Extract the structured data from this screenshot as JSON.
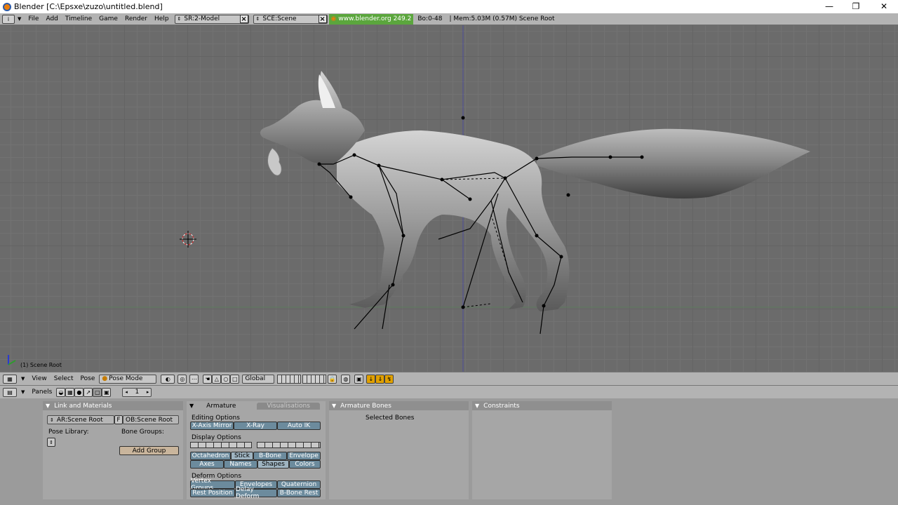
{
  "window": {
    "title": "Blender [C:\\Epsxe\\zuzo\\untitled.blend]",
    "minimize": "—",
    "restore": "❐",
    "close": "✕"
  },
  "menubar": {
    "items": [
      "File",
      "Add",
      "Timeline",
      "Game",
      "Render",
      "Help"
    ],
    "screen_field": "SR:2-Model",
    "scene_field": "SCE:Scene",
    "url": "www.blender.org 249.2",
    "stats_bo": "Bo:0-48",
    "stats_mem": "| Mem:5.03M (0.57M) Scene Root"
  },
  "viewport": {
    "object_label": "(1) Scene Root"
  },
  "view3d_header": {
    "menus": [
      "View",
      "Select",
      "Pose"
    ],
    "mode": "Pose Mode",
    "orientation": "Global"
  },
  "buttons_header": {
    "panels_label": "Panels",
    "frame": "1"
  },
  "panels": {
    "link": {
      "title": "Link and Materials",
      "ar_field": "AR:Scene Root",
      "f_btn": "F",
      "ob_field": "OB:Scene Root",
      "pose_library": "Pose Library:",
      "bone_groups": "Bone Groups:",
      "add_group": "Add Group"
    },
    "armature": {
      "tab_active": "Armature",
      "tab_other": "Visualisations",
      "editing": "Editing Options",
      "x_axis_mirror": "X-Axis Mirror",
      "x_ray": "X-Ray",
      "auto_ik": "Auto IK",
      "display": "Display Options",
      "octahedron": "Octahedron",
      "stick": "Stick",
      "b_bone": "B-Bone",
      "envelope": "Envelope",
      "axes": "Axes",
      "names": "Names",
      "shapes": "Shapes",
      "colors": "Colors",
      "deform": "Deform Options",
      "vertex_groups": "Vertex Groups",
      "envelopes": "Envelopes",
      "quaternion": "Quaternion",
      "rest_position": "Rest Position",
      "delay_deform": "Delay Deform",
      "b_bone_rest": "B-Bone Rest"
    },
    "bones": {
      "title": "Armature Bones",
      "selected": "Selected Bones"
    },
    "constraints": {
      "title": "Constraints"
    }
  }
}
